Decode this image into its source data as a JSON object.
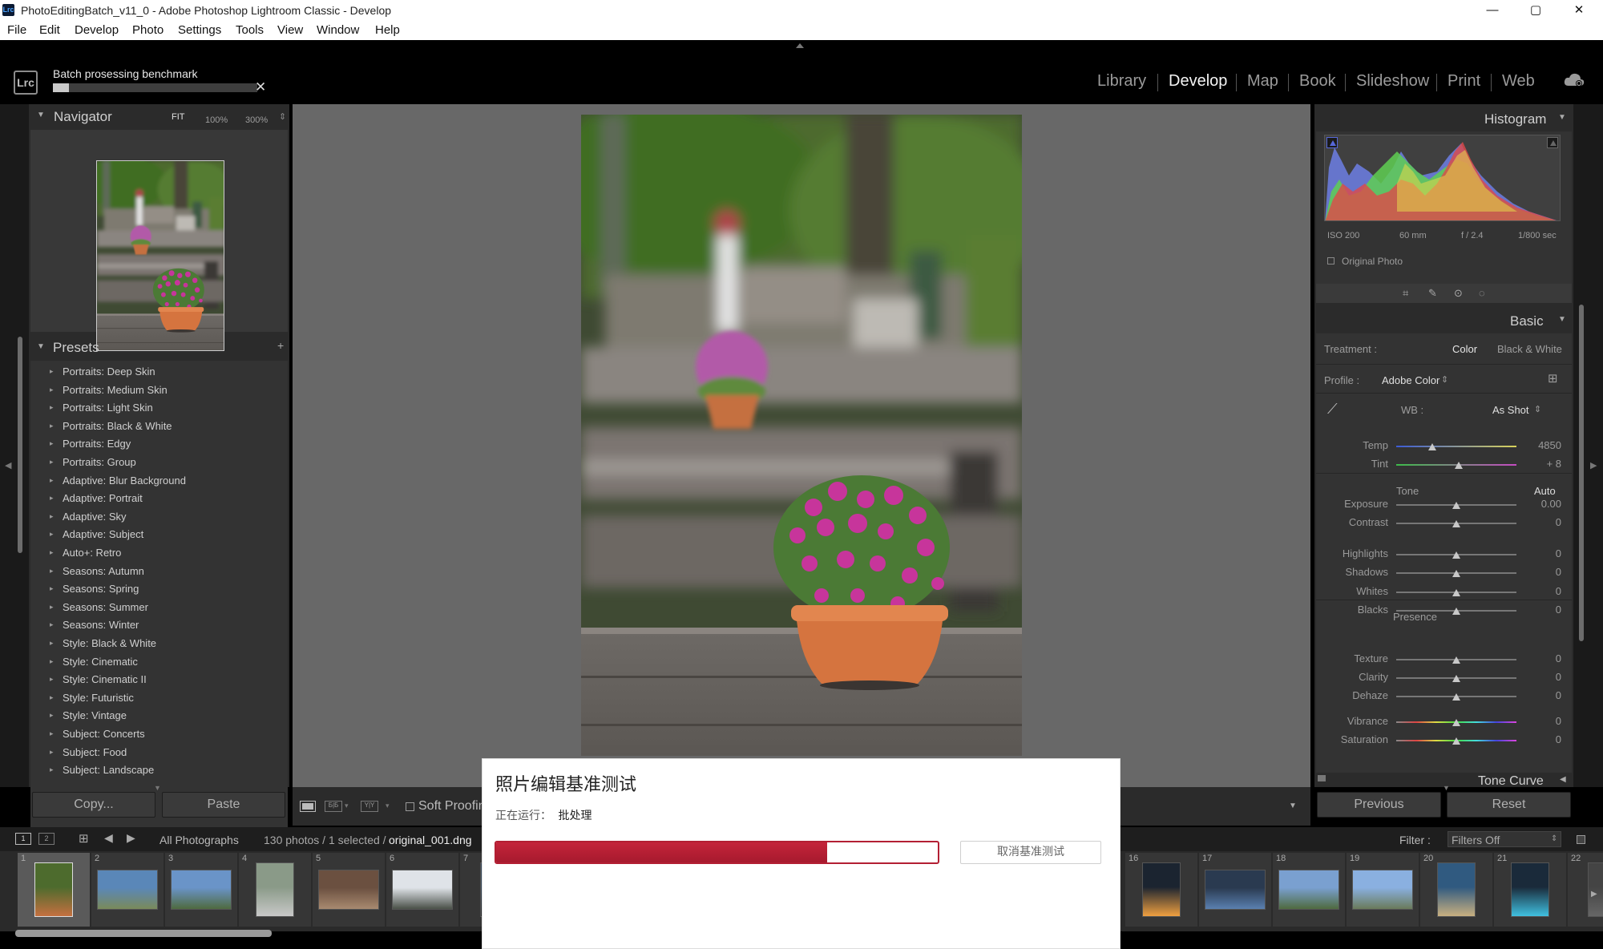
{
  "window": {
    "title": "PhotoEditingBatch_v11_0 - Adobe Photoshop Lightroom Classic - Develop",
    "app_icon": "Lrc",
    "minimize_icon": "—",
    "maximize_icon": "▢",
    "close_icon": "✕"
  },
  "menu": [
    "File",
    "Edit",
    "Develop",
    "Photo",
    "Settings",
    "Tools",
    "View",
    "Window",
    "Help"
  ],
  "identity": {
    "logo": "Lrc",
    "job_label": "Batch prosessing benchmark",
    "job_progress": 0.08,
    "job_close": "✕"
  },
  "modules": [
    "Library",
    "Develop",
    "Map",
    "Book",
    "Slideshow",
    "Print",
    "Web"
  ],
  "active_module": "Develop",
  "navigator": {
    "title": "Navigator",
    "fit": "FIT",
    "z100": "100%",
    "z300": "300%"
  },
  "presets": {
    "title": "Presets",
    "add": "+",
    "items": [
      "Portraits: Deep Skin",
      "Portraits: Medium Skin",
      "Portraits: Light Skin",
      "Portraits: Black & White",
      "Portraits: Edgy",
      "Portraits: Group",
      "Adaptive: Blur Background",
      "Adaptive: Portrait",
      "Adaptive: Sky",
      "Adaptive: Subject",
      "Auto+: Retro",
      "Seasons: Autumn",
      "Seasons: Spring",
      "Seasons: Summer",
      "Seasons: Winter",
      "Style: Black & White",
      "Style: Cinematic",
      "Style: Cinematic II",
      "Style: Futuristic",
      "Style: Vintage",
      "Subject: Concerts",
      "Subject: Food",
      "Subject: Landscape"
    ]
  },
  "left_buttons": {
    "copy": "Copy...",
    "paste": "Paste"
  },
  "toolbar": {
    "soft_proofing": "Soft Proofing"
  },
  "histogram": {
    "title": "Histogram",
    "iso": "ISO 200",
    "focal": "60 mm",
    "aperture": "f / 2.4",
    "shutter": "1/800 sec",
    "original_photo": "Original Photo"
  },
  "basic": {
    "title": "Basic",
    "treatment_label": "Treatment :",
    "treatment_color": "Color",
    "treatment_bw": "Black & White",
    "profile_label": "Profile :",
    "profile_value": "Adobe Color",
    "wb_label": "WB :",
    "wb_value": "As Shot",
    "tone_label": "Tone",
    "auto_label": "Auto",
    "presence_label": "Presence",
    "sliders": [
      {
        "label": "Temp",
        "value": "4850",
        "pos": 0.3
      },
      {
        "label": "Tint",
        "value": "+ 8",
        "pos": 0.52
      },
      {
        "label": "Exposure",
        "value": "0.00",
        "pos": 0.5
      },
      {
        "label": "Contrast",
        "value": "0",
        "pos": 0.5
      },
      {
        "label": "Highlights",
        "value": "0",
        "pos": 0.5
      },
      {
        "label": "Shadows",
        "value": "0",
        "pos": 0.5
      },
      {
        "label": "Whites",
        "value": "0",
        "pos": 0.5
      },
      {
        "label": "Blacks",
        "value": "0",
        "pos": 0.5
      },
      {
        "label": "Texture",
        "value": "0",
        "pos": 0.5
      },
      {
        "label": "Clarity",
        "value": "0",
        "pos": 0.5
      },
      {
        "label": "Dehaze",
        "value": "0",
        "pos": 0.5
      },
      {
        "label": "Vibrance",
        "value": "0",
        "pos": 0.5
      },
      {
        "label": "Saturation",
        "value": "0",
        "pos": 0.5
      }
    ]
  },
  "tone_curve": {
    "title": "Tone Curve"
  },
  "right_buttons": {
    "previous": "Previous",
    "reset": "Reset"
  },
  "filmstrip_bar": {
    "view1": "1",
    "view2": "2",
    "source": "All Photographs",
    "count": "130 photos / 1 selected / ",
    "filename": "original_001.dng",
    "filter_label": "Filter :",
    "filter_value": "Filters Off"
  },
  "filmstrip_numbers": [
    "1",
    "2",
    "3",
    "4",
    "5",
    "6",
    "7",
    "16",
    "17",
    "18",
    "19",
    "20",
    "21",
    "22"
  ],
  "dialog": {
    "title": "照片编辑基准测试",
    "status_label": "正在运行：",
    "status_value": "批处理",
    "progress": 0.75,
    "cancel": "取消基准测试"
  }
}
